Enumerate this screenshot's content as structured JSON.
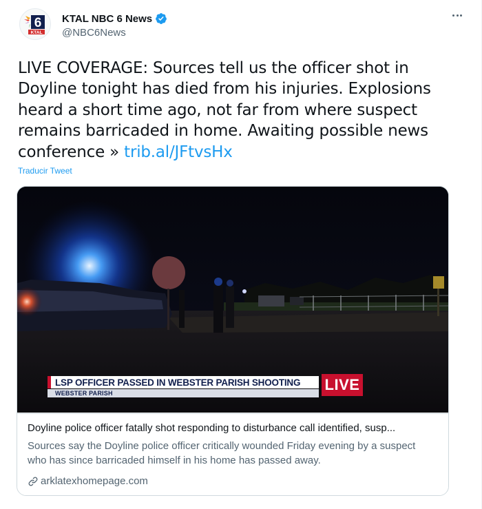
{
  "account": {
    "display_name": "KTAL NBC 6 News",
    "handle": "@NBC6News",
    "verified": true,
    "avatar_logo_text": "6",
    "avatar_station_text": "KTAL"
  },
  "tweet": {
    "text": "LIVE COVERAGE: Sources tell us the officer shot in Doyline tonight has died from his injuries. Explosions heard a short time ago, not far from where suspect remains barricaded in home. Awaiting possible news conference » ",
    "link_text": "trib.al/JFtvsHx",
    "translate_label": "Traducir Tweet"
  },
  "card": {
    "headline": "LSP OFFICER PASSED IN WEBSTER PARISH SHOOTING",
    "subline": "WEBSTER PARISH",
    "live_label": "LIVE",
    "title": "Doyline police officer fatally shot responding to disturbance call identified, susp...",
    "description": "Sources say the Doyline police officer critically wounded Friday evening by a suspect who has since barricaded himself in his home has passed away.",
    "domain": "arklatexhomepage.com"
  },
  "colors": {
    "link_blue": "#1d9bf0",
    "verified_blue": "#1d9bf0",
    "live_red": "#c8102e",
    "text_secondary": "#536471"
  },
  "icons": {
    "verified": "verified-badge-icon",
    "more": "more-horizontal-icon",
    "link": "link-icon"
  }
}
